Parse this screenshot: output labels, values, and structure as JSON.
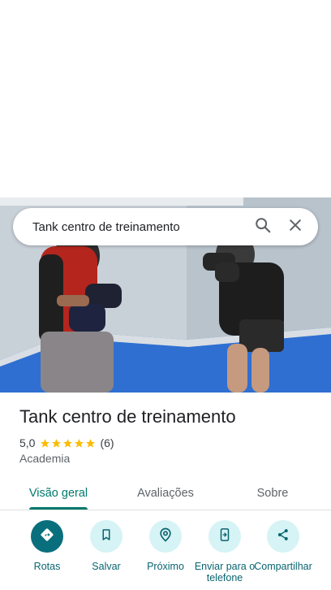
{
  "search": {
    "query": "Tank centro de treinamento"
  },
  "place": {
    "name": "Tank centro de treinamento",
    "rating": "5,0",
    "rating_value": 5,
    "review_count": "(6)",
    "category": "Academia"
  },
  "tabs": [
    {
      "label": "Visão geral",
      "active": true
    },
    {
      "label": "Avaliações",
      "active": false
    },
    {
      "label": "Sobre",
      "active": false
    }
  ],
  "actions": [
    {
      "label": "Rotas",
      "icon": "directions-icon"
    },
    {
      "label": "Salvar",
      "icon": "bookmark-icon"
    },
    {
      "label": "Próximo",
      "icon": "nearby-icon"
    },
    {
      "label": "Enviar para o telefone",
      "icon": "send-to-phone-icon"
    },
    {
      "label": "Compartilhar",
      "icon": "share-icon"
    }
  ],
  "colors": {
    "accent": "#00796b",
    "action_bg": "#d6f3f5",
    "star": "#fbbc04"
  }
}
